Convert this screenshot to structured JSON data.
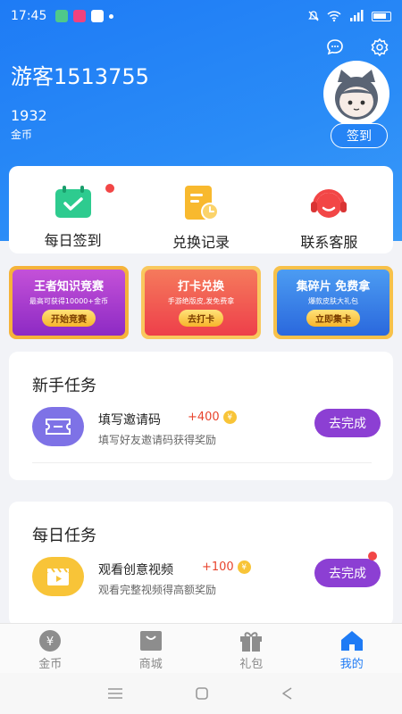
{
  "status_bar": {
    "time": "17:45"
  },
  "profile": {
    "username": "游客1513755",
    "coins": "1932",
    "coins_label": "金币",
    "checkin_button": "签到"
  },
  "quick_actions": [
    {
      "label": "每日签到",
      "icon": "calendar-check-icon",
      "color": "#2ecb8f"
    },
    {
      "label": "兑换记录",
      "icon": "record-icon",
      "color": "#f8b92e"
    },
    {
      "label": "联系客服",
      "icon": "headset-icon",
      "color": "#f24646"
    }
  ],
  "banners": [
    {
      "title": "王者知识竞赛",
      "subtitle": "最高可获得10000+金币",
      "button": "开始竞赛",
      "color": "#a73ad0"
    },
    {
      "title": "打卡兑换",
      "subtitle": "手游绝版皮,发免费拿",
      "button": "去打卡",
      "color": "#f1553d"
    },
    {
      "title": "集碎片 免费拿",
      "subtitle": "爆款皮肤大礼包",
      "button": "立即集卡",
      "color": "#2f7fe8"
    }
  ],
  "newbie_tasks": {
    "title": "新手任务",
    "items": [
      {
        "name": "填写邀请码",
        "reward": "+400",
        "desc": "填写好友邀请码获得奖励",
        "button": "去完成"
      }
    ]
  },
  "daily_tasks": {
    "title": "每日任务",
    "items": [
      {
        "name": "观看创意视频",
        "reward": "+100",
        "desc": "观看完整视频得高额奖励",
        "button": "去完成"
      }
    ]
  },
  "coin_symbol": "¥",
  "tabs": [
    {
      "label": "金币",
      "icon": "coin-icon",
      "active": false
    },
    {
      "label": "商城",
      "icon": "shop-bag-icon",
      "active": false
    },
    {
      "label": "礼包",
      "icon": "gift-icon",
      "active": false
    },
    {
      "label": "我的",
      "icon": "home-icon",
      "active": true
    }
  ],
  "colors": {
    "primary": "#1e7bf5",
    "task_button": "#8c3fd3",
    "reward": "#e8442d"
  }
}
